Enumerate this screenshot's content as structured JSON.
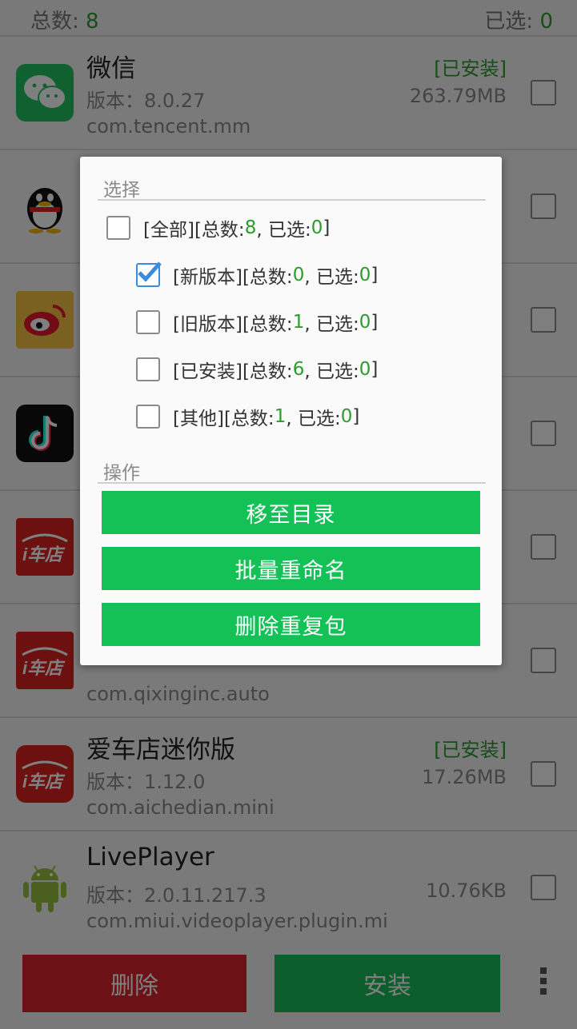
{
  "summary": {
    "total_label": "总数: ",
    "total": "8",
    "selected_label": "已选: ",
    "selected": "0"
  },
  "apps": [
    {
      "name": "微信",
      "version": "版本：8.0.27",
      "package": "com.tencent.mm",
      "status": "[已安装]",
      "size": "263.79MB",
      "icon": "wechat-icon"
    },
    {
      "name": "",
      "version": "",
      "package": "",
      "status": "",
      "size": "",
      "icon": "qq-icon"
    },
    {
      "name": "",
      "version": "",
      "package": "",
      "status": "",
      "size": "",
      "icon": "weibo-icon"
    },
    {
      "name": "",
      "version": "",
      "package": "",
      "status": "",
      "size": "",
      "icon": "tiktok-icon"
    },
    {
      "name": "",
      "version": "",
      "package": "",
      "status": "",
      "size": "",
      "icon": "ichedian-icon"
    },
    {
      "name": "",
      "version": "",
      "package": "com.qixinginc.auto",
      "status": "",
      "size": "",
      "icon": "ichedian-icon"
    },
    {
      "name": "爱车店迷你版",
      "version": "版本：1.12.0",
      "package": "com.aichedian.mini",
      "status": "[已安装]",
      "size": "17.26MB",
      "icon": "ichedian-mini-icon"
    },
    {
      "name": "LivePlayer",
      "version": "版本：2.0.11.217.3",
      "package": "com.miui.videoplayer.plugin.mi",
      "status": "",
      "size": "10.76KB",
      "icon": "android-icon"
    }
  ],
  "bottom": {
    "delete_label": "删除",
    "install_label": "安装"
  },
  "dialog": {
    "select_title": "选择",
    "options": [
      {
        "name": "[全部]",
        "stats_prefix": " [总数: ",
        "total": "8",
        "mid": ", 已选: ",
        "selected": "0",
        "suffix": "]",
        "checked": false
      },
      {
        "name": "[新版本]",
        "stats_prefix": " [总数: ",
        "total": "0",
        "mid": ", 已选: ",
        "selected": "0",
        "suffix": "]",
        "checked": true
      },
      {
        "name": "[旧版本]",
        "stats_prefix": " [总数: ",
        "total": "1",
        "mid": ", 已选: ",
        "selected": "0",
        "suffix": "]",
        "checked": false
      },
      {
        "name": "[已安装]",
        "stats_prefix": " [总数: ",
        "total": "6",
        "mid": ", 已选: ",
        "selected": "0",
        "suffix": "]",
        "checked": false
      },
      {
        "name": "[其他]",
        "stats_prefix": " [总数: ",
        "total": "1",
        "mid": ", 已选: ",
        "selected": "0",
        "suffix": "]",
        "checked": false
      }
    ],
    "action_title": "操作",
    "actions": [
      "移至目录",
      "批量重命名",
      "删除重复包"
    ]
  },
  "colors": {
    "accent_green": "#14c157",
    "delete_red": "#d9222b",
    "count_green": "#2e9b2e"
  }
}
